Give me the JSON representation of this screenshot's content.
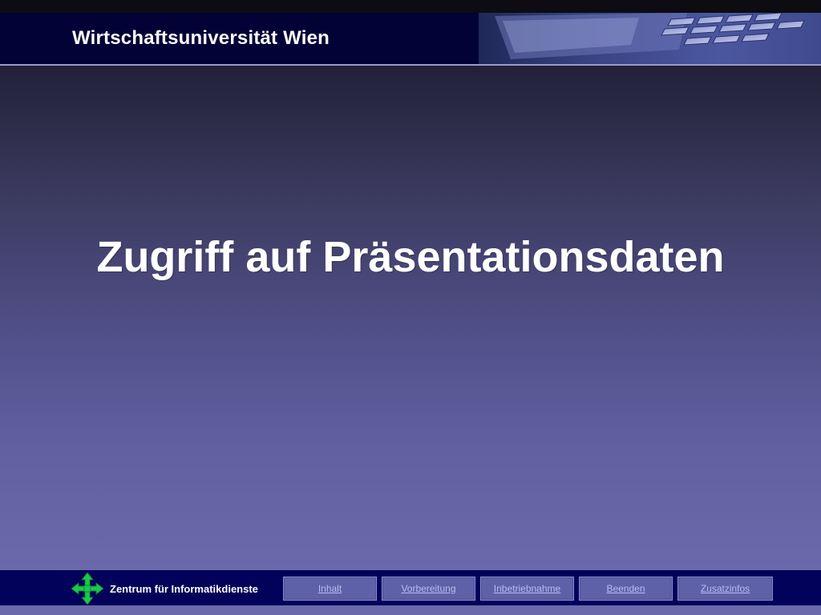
{
  "header": {
    "title": "Wirtschaftsuniversität Wien"
  },
  "slide": {
    "title": "Zugriff auf Präsentationsdaten"
  },
  "footer": {
    "logo_icon": "green-four-arrow-icon",
    "label": "Zentrum für Informatikdienste",
    "nav": [
      {
        "label": "Inhalt"
      },
      {
        "label": "Vorbereitung"
      },
      {
        "label": "Inbetriebnahme"
      },
      {
        "label": "Beenden"
      },
      {
        "label": "Zusatzinfos"
      }
    ]
  },
  "colors": {
    "header_bg": "#020236",
    "footer_bg": "#02025a",
    "nav_button": "#5f61a8",
    "logo_green": "#18c94a"
  }
}
